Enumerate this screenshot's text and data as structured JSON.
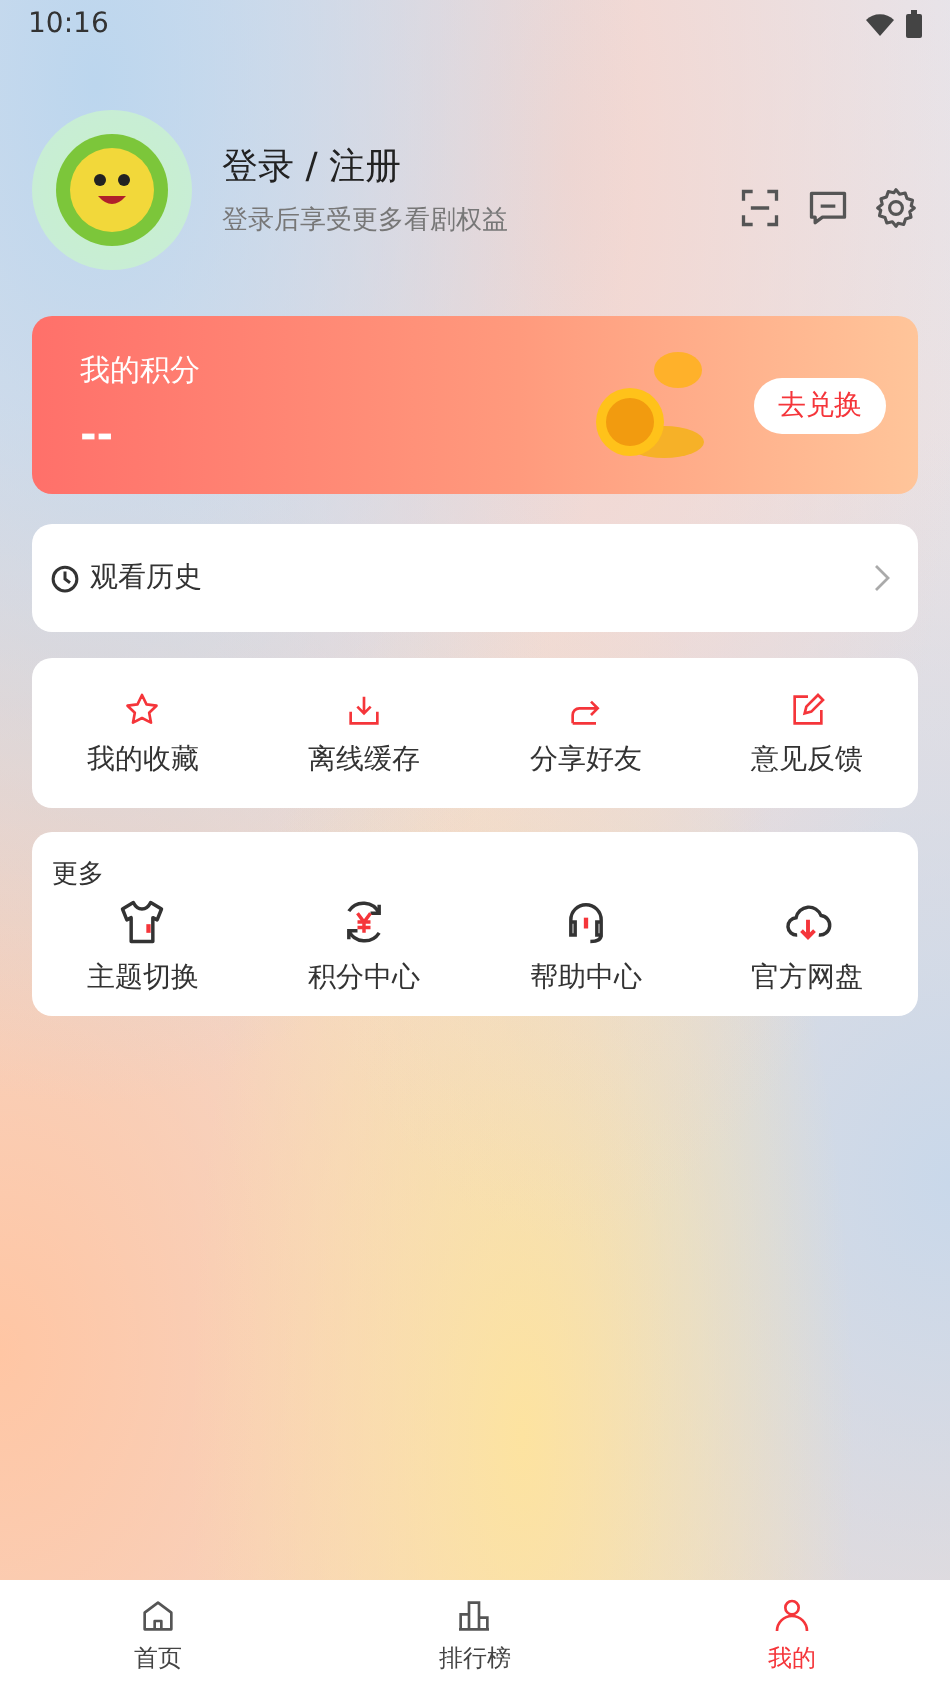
{
  "status_bar": {
    "time": "10:16"
  },
  "profile": {
    "title": "登录 / 注册",
    "subtitle": "登录后享受更多看剧权益"
  },
  "points": {
    "title": "我的积分",
    "value": "--",
    "button": "去兑换"
  },
  "history": {
    "label": "观看历史"
  },
  "shortcuts": [
    {
      "label": "我的收藏"
    },
    {
      "label": "离线缓存"
    },
    {
      "label": "分享好友"
    },
    {
      "label": "意见反馈"
    }
  ],
  "more": {
    "title": "更多",
    "items": [
      {
        "label": "主题切换"
      },
      {
        "label": "积分中心"
      },
      {
        "label": "帮助中心"
      },
      {
        "label": "官方网盘"
      }
    ]
  },
  "tab_bar": [
    {
      "label": "首页",
      "selected": false
    },
    {
      "label": "排行榜",
      "selected": false
    },
    {
      "label": "我的",
      "selected": true
    }
  ]
}
